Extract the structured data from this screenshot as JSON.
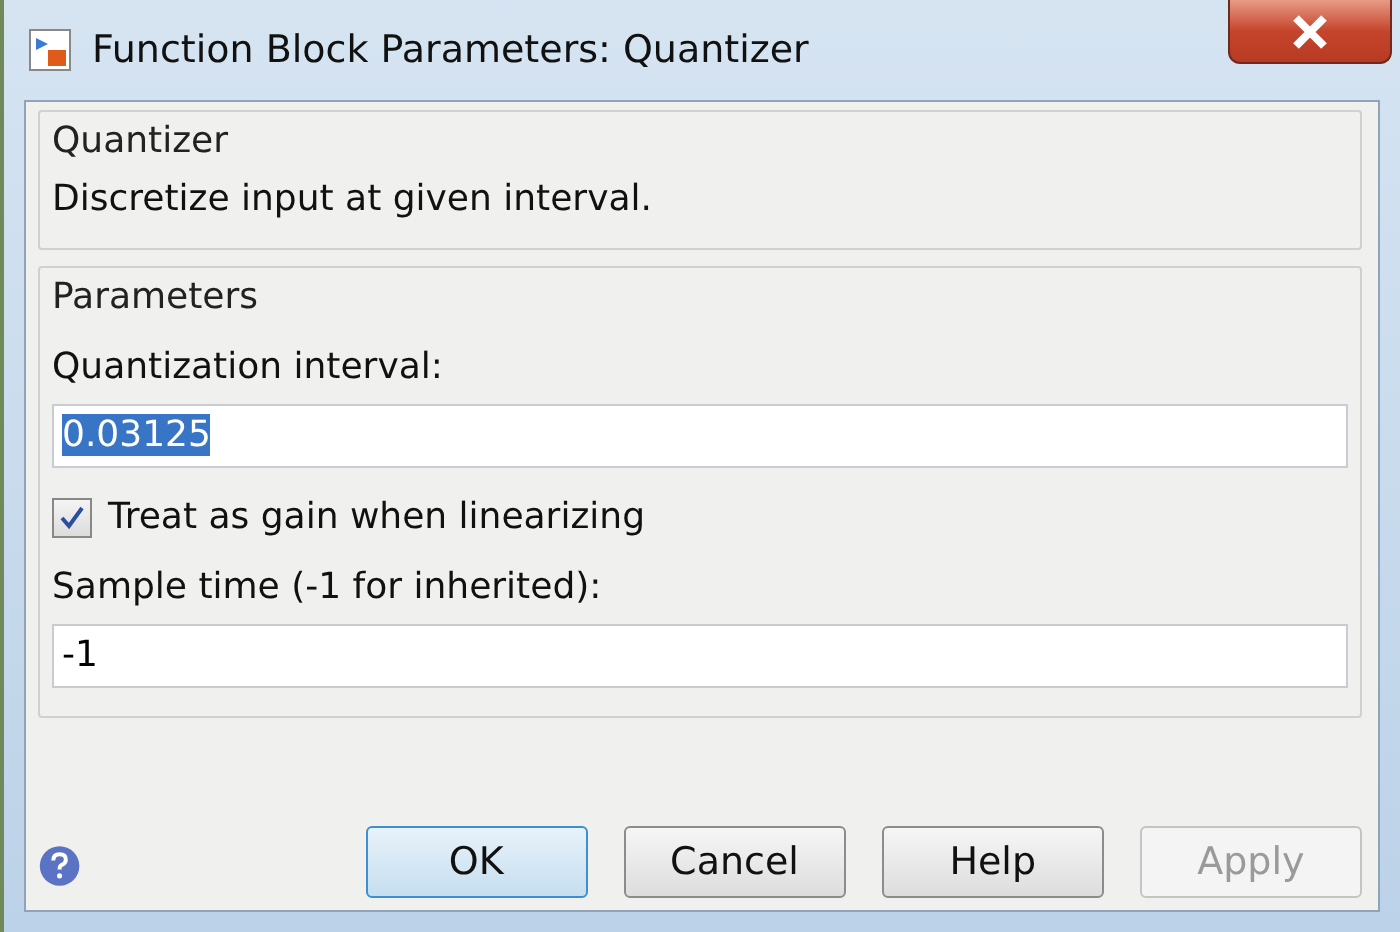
{
  "window": {
    "title": "Function Block Parameters: Quantizer"
  },
  "description": {
    "title": "Quantizer",
    "text": "Discretize input at given interval."
  },
  "parameters": {
    "title": "Parameters",
    "fields": [
      {
        "kind": "text",
        "label": "Quantization interval:",
        "value": "0.03125",
        "selected": true
      },
      {
        "kind": "checkbox",
        "label": "Treat as gain when linearizing",
        "checked": true
      },
      {
        "kind": "text",
        "label": "Sample time (-1 for inherited):",
        "value": "-1",
        "selected": false
      }
    ]
  },
  "buttons": [
    {
      "label": "OK",
      "default": true,
      "disabled": false
    },
    {
      "label": "Cancel",
      "default": false,
      "disabled": false
    },
    {
      "label": "Help",
      "default": false,
      "disabled": false
    },
    {
      "label": "Apply",
      "default": false,
      "disabled": true
    }
  ]
}
